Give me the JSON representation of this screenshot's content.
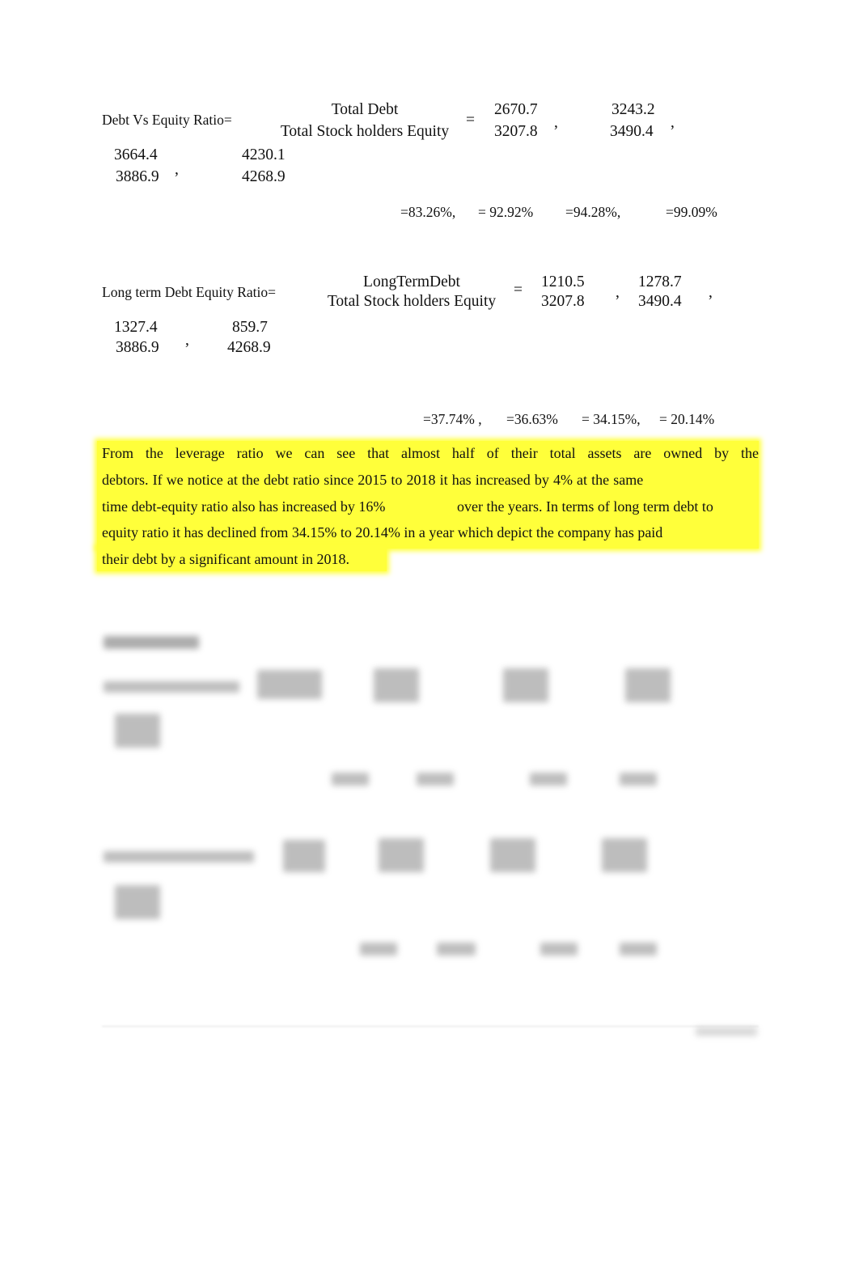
{
  "debt_equity": {
    "label": "Debt Vs Equity Ratio=",
    "numerator": "Total Debt",
    "denominator": "Total Stock holders Equity",
    "equals": "=",
    "fractions": [
      {
        "num": "2670.7",
        "den": "3207.8"
      },
      {
        "num": "3243.2",
        "den": "3490.4"
      },
      {
        "num": "3664.4",
        "den": "3886.9"
      },
      {
        "num": "4230.1",
        "den": "4268.9"
      }
    ],
    "comma": ",",
    "results": [
      "=83.26%,",
      "= 92.92%",
      "=94.28%,",
      "=99.09%"
    ]
  },
  "long_term": {
    "label": "Long term Debt Equity Ratio=",
    "numerator": "LongTermDebt",
    "denominator": "Total Stock holders Equity",
    "equals": "=",
    "fractions": [
      {
        "num": "1210.5",
        "den": "3207.8"
      },
      {
        "num": "1278.7",
        "den": "3490.4"
      },
      {
        "num": "1327.4",
        "den": "3886.9"
      },
      {
        "num": "859.7",
        "den": "4268.9"
      }
    ],
    "comma": ",",
    "results": [
      "=37.74% ,",
      "=36.63%",
      "= 34.15%,",
      "= 20.14%"
    ]
  },
  "paragraph": {
    "highlight_color": "#ffff3a",
    "lines": [
      "From the leverage ratio we can see that almost half of their total assets are owned by the",
      "debtors. If we notice at the debt ratio since 2015 to 2018 it has increased by 4% at the same",
      "time debt-equity ratio also has increased by 16%",
      "over the years. In terms of long term debt to",
      "equity ratio it has declined from 34.15% to 20.14% in a year which depict the company has paid",
      "their debt by a significant amount in 2018."
    ]
  }
}
